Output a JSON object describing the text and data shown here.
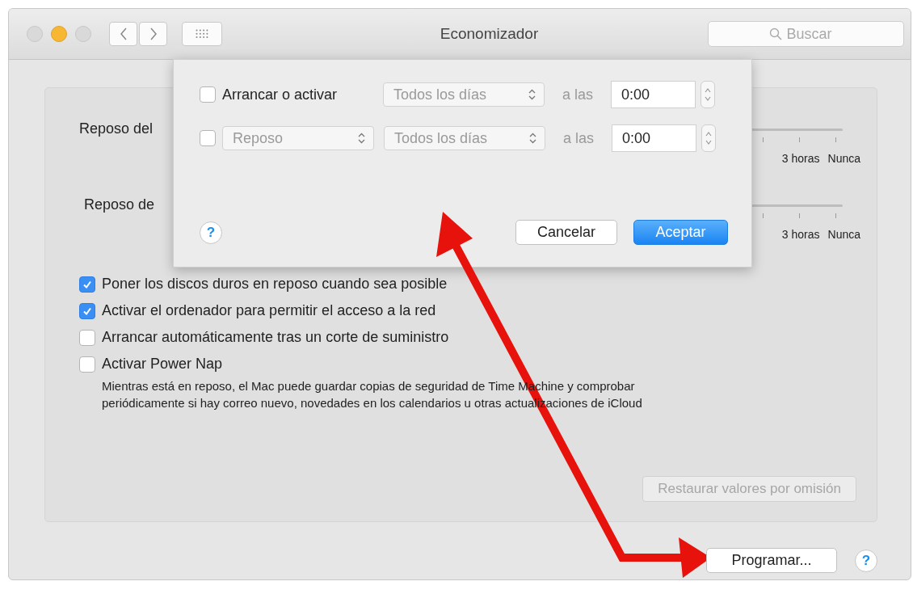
{
  "window": {
    "title": "Economizador",
    "search": {
      "placeholder": "Buscar"
    }
  },
  "sleep_sliders": [
    {
      "label": "Reposo del",
      "tick_labels": [
        "3 horas",
        "Nunca"
      ]
    },
    {
      "label": "Reposo de",
      "tick_labels": [
        "3 horas",
        "Nunca"
      ]
    }
  ],
  "options": [
    {
      "label": "Poner los discos duros en reposo cuando sea posible",
      "checked": true
    },
    {
      "label": "Activar el ordenador para permitir el acceso a la red",
      "checked": true
    },
    {
      "label": "Arrancar automáticamente tras un corte de suministro",
      "checked": false
    },
    {
      "label": "Activar Power Nap",
      "checked": false,
      "description": "Mientras está en reposo, el Mac puede guardar copias de seguridad de Time Machine y comprobar periódicamente si hay correo nuevo, novedades en los calendarios u otras actualizaciones de iCloud"
    }
  ],
  "restore_button": {
    "label": "Restaurar valores por omisión",
    "disabled": true
  },
  "schedule_button": {
    "label": "Programar..."
  },
  "help": "?",
  "schedule_sheet": {
    "rows": [
      {
        "kind": "fixed",
        "checked": false,
        "action": "Arrancar o activar",
        "day": "Todos los días",
        "at": "a las",
        "time": "0:00"
      },
      {
        "kind": "popup",
        "checked": false,
        "action": "Reposo",
        "day": "Todos los días",
        "at": "a las",
        "time": "0:00"
      }
    ],
    "help": "?",
    "cancel": "Cancelar",
    "ok": "Aceptar"
  }
}
